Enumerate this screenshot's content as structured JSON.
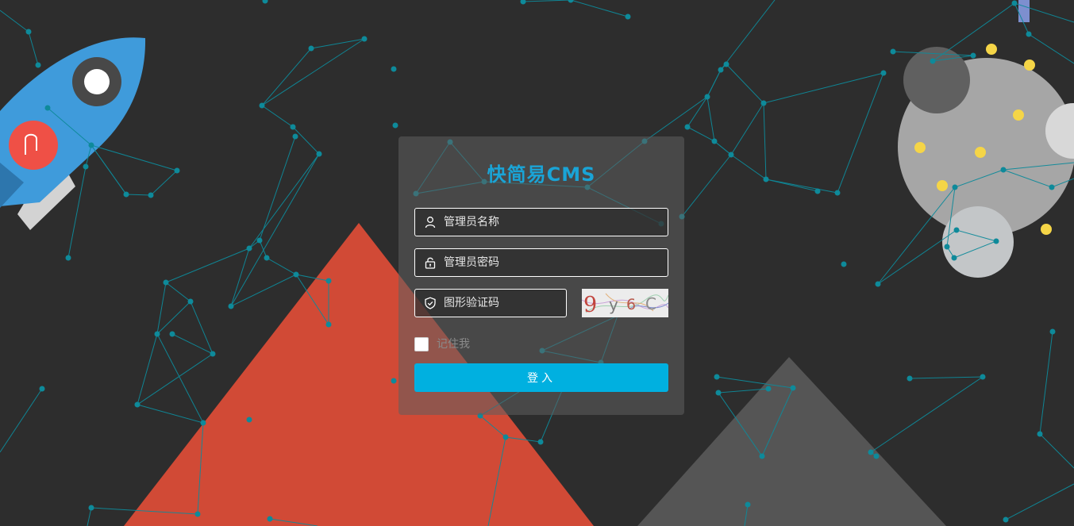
{
  "login": {
    "title": "快简易CMS",
    "username_placeholder": "管理员名称",
    "password_placeholder": "管理员密码",
    "captcha_placeholder": "图形验证码",
    "captcha_text": "9y6C",
    "remember_label": "记住我",
    "submit_label": "登入"
  },
  "icons": {
    "username": "user-icon",
    "password": "lock-icon",
    "captcha": "shield-check-icon"
  },
  "colors": {
    "background": "#2d2d2d",
    "accent": "#1aa4d6",
    "button": "#00b0e0",
    "network": "#0e8a9a",
    "red_mountain": "#d14a36",
    "grey_mountain": "#555555",
    "planet": "#a6a6a6",
    "planet_spots": "#f5d547",
    "rocket_body": "#3c97d9",
    "rocket_badge": "#ef5046"
  }
}
